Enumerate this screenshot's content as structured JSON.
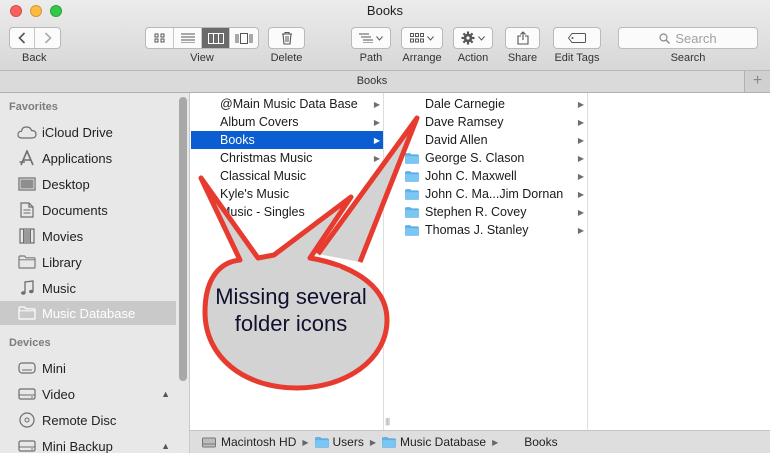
{
  "window": {
    "title": "Books"
  },
  "toolbar": {
    "back_label": "Back",
    "view_label": "View",
    "delete_label": "Delete",
    "path_label": "Path",
    "arrange_label": "Arrange",
    "action_label": "Action",
    "share_label": "Share",
    "edit_tags_label": "Edit Tags",
    "search_label": "Search",
    "search_placeholder": "Search",
    "view_mode_selected": "columns"
  },
  "tabbar": {
    "tab_title": "Books",
    "add_glyph": "+"
  },
  "sidebar": {
    "favorites_header": "Favorites",
    "favorites": [
      {
        "label": "iCloud Drive",
        "icon": "cloud-icon"
      },
      {
        "label": "Applications",
        "icon": "applications-icon"
      },
      {
        "label": "Desktop",
        "icon": "desktop-icon"
      },
      {
        "label": "Documents",
        "icon": "documents-icon"
      },
      {
        "label": "Movies",
        "icon": "movies-icon"
      },
      {
        "label": "Library",
        "icon": "folder-icon"
      },
      {
        "label": "Music",
        "icon": "music-note-icon"
      },
      {
        "label": "Music Database",
        "icon": "folder-icon",
        "selected": true
      }
    ],
    "devices_header": "Devices",
    "devices": [
      {
        "label": "Mini",
        "icon": "computer-icon"
      },
      {
        "label": "Video",
        "icon": "hard-drive-icon",
        "eject": true
      },
      {
        "label": "Remote Disc",
        "icon": "disc-icon"
      },
      {
        "label": "Mini Backup",
        "icon": "hard-drive-icon",
        "eject": true
      }
    ]
  },
  "column1": {
    "items": [
      {
        "label": "@Main Music Data Base"
      },
      {
        "label": "Album Covers"
      },
      {
        "label": "Books",
        "selected": true
      },
      {
        "label": "Christmas Music"
      },
      {
        "label": "Classical Music"
      },
      {
        "label": "Kyle's Music"
      },
      {
        "label": "Music - Singles"
      }
    ]
  },
  "column2": {
    "items": [
      {
        "label": "Dale Carnegie",
        "has_icon": false
      },
      {
        "label": "Dave Ramsey",
        "has_icon": false
      },
      {
        "label": "David Allen",
        "has_icon": false
      },
      {
        "label": "George S. Clason",
        "has_icon": true
      },
      {
        "label": "John C. Maxwell",
        "has_icon": true
      },
      {
        "label": "John C. Ma...Jim Dornan",
        "has_icon": true
      },
      {
        "label": "Stephen R. Covey",
        "has_icon": true
      },
      {
        "label": "Thomas J. Stanley",
        "has_icon": true
      }
    ]
  },
  "pathbar": {
    "crumbs": [
      {
        "label": "Macintosh HD",
        "icon": "hard-drive-icon"
      },
      {
        "label": "Users",
        "icon": "folder-icon"
      },
      {
        "label": "Music Database",
        "icon": "folder-icon"
      },
      {
        "label": "Books",
        "icon": "none"
      }
    ]
  },
  "annotation": {
    "text": "Missing several folder icons",
    "fill": "#d3d3d3",
    "stroke": "#e63b2e"
  },
  "colors": {
    "selection": "#0b5ed1",
    "folder": "#5bb4ec"
  }
}
